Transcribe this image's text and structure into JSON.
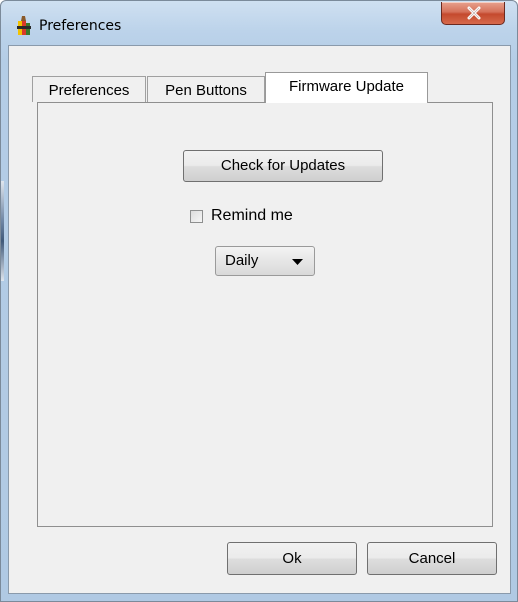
{
  "window": {
    "title": "Preferences",
    "close_label": "X"
  },
  "tabs": [
    {
      "label": "Preferences",
      "active": false
    },
    {
      "label": "Pen Buttons",
      "active": false
    },
    {
      "label": "Firmware Update",
      "active": true
    }
  ],
  "firmware_panel": {
    "check_updates_label": "Check for Updates",
    "remind_label": "Remind me",
    "remind_checked": false,
    "frequency_selected": "Daily"
  },
  "footer": {
    "ok_label": "Ok",
    "cancel_label": "Cancel"
  },
  "colors": {
    "title_bar": "#bcd3ea",
    "client_bg": "#f0f0f0",
    "close_button": "#c44a2e"
  },
  "icons": {
    "app": "app-icon",
    "close": "close-icon",
    "dropdown": "chevron-down-icon"
  }
}
